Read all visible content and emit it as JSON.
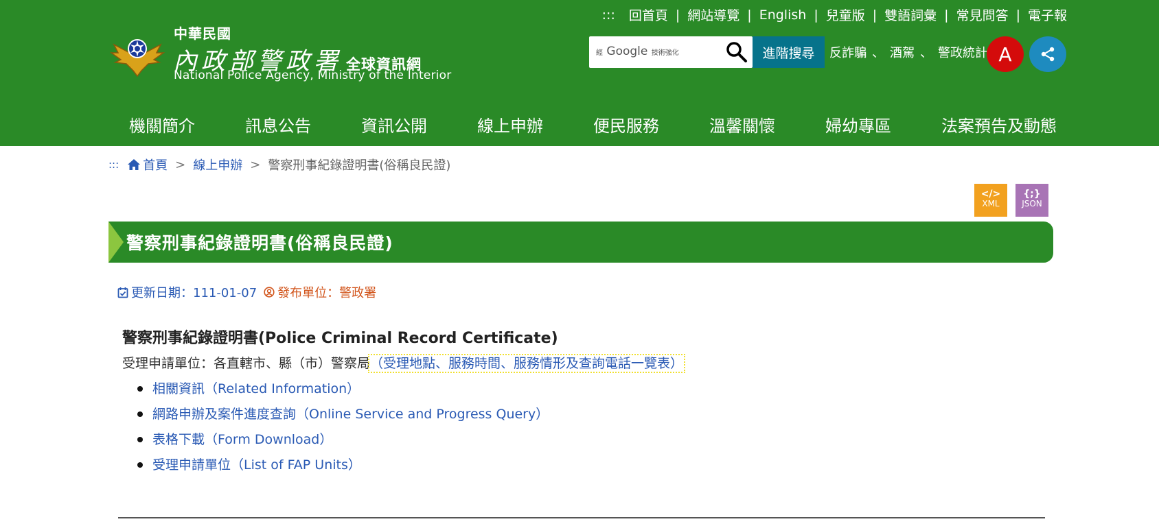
{
  "header": {
    "logo": {
      "roc": "中華民國",
      "agency": "內政部警政署",
      "site": "全球資訊網",
      "english": "National Police Agency, Ministry of the Interior"
    },
    "top_links": {
      "accesskey": ":::",
      "items": [
        "回首頁",
        "網站導覽",
        "English",
        "兒童版",
        "雙語詞彙",
        "常見問答",
        "電子報"
      ]
    },
    "search": {
      "google_label": "Google",
      "google_prefix": "經",
      "google_suffix": "技術強化",
      "advanced_button": "進階搜尋"
    },
    "quick_links": [
      "反詐騙",
      "酒駕",
      "警政統計"
    ],
    "font_size_button": "A",
    "share_icon": "share-icon",
    "nav": [
      "機關簡介",
      "訊息公告",
      "資訊公開",
      "線上申辦",
      "便民服務",
      "溫馨關懷",
      "婦幼專區",
      "法案預告及動態"
    ]
  },
  "breadcrumb": {
    "accesskey": ":::",
    "home": "首頁",
    "parent": "線上申辦",
    "current": "警察刑事紀錄證明書(俗稱良民證)"
  },
  "downloads": {
    "xml": {
      "symbol": "</>",
      "label": "XML"
    },
    "json": {
      "symbol": "{;}",
      "label": "JSON"
    }
  },
  "page": {
    "title": "警察刑事紀錄證明書(俗稱良民證)",
    "update_label": "更新日期：111-01-07",
    "publisher_label": "發布單位：警政署"
  },
  "content": {
    "heading": "警察刑事紀錄證明書(Police Criminal Record Certificate)",
    "accept_prefix": "受理申請單位：各直轄市、縣（市）警察局",
    "accept_link": "（受理地點、服務時間、服務情形及查詢電話一覽表）",
    "links": [
      "相關資訊（Related Information）",
      "網路申辦及案件進度查詢（Online Service and Progress Query）",
      "表格下載（Form Download）",
      "受理申請單位（List of FAP Units）"
    ]
  },
  "colors": {
    "header_green": "#2a8a27",
    "title_arrow": "#8cc63f",
    "link_blue": "#2a5ab4",
    "publisher_orange": "#d2561d",
    "search_button": "#06738b",
    "font_button_red": "#d40b0b",
    "share_blue": "#1e8bbf",
    "xml_orange": "#f2a11f",
    "json_purple": "#a874b5"
  }
}
